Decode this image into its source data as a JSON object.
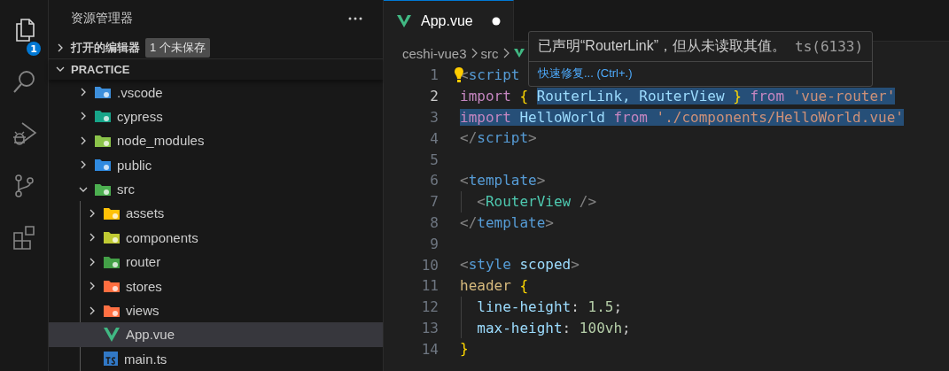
{
  "activity_bar": {
    "items": [
      {
        "kind": "explorer",
        "selected": true,
        "badge": "1"
      },
      {
        "kind": "search",
        "selected": false
      },
      {
        "kind": "debug",
        "selected": false
      },
      {
        "kind": "source-control",
        "selected": false
      },
      {
        "kind": "extensions",
        "selected": false
      }
    ]
  },
  "sidebar": {
    "title": "资源管理器",
    "sections": [
      {
        "title": "打开的编辑器",
        "expanded": false,
        "badge": "1 个未保存"
      },
      {
        "title": "PRACTICE",
        "expanded": true
      }
    ],
    "tree": [
      {
        "label": ".vscode",
        "kind": "folder",
        "color": "#3d8fdc",
        "expanded": false,
        "selected": false
      },
      {
        "label": "cypress",
        "kind": "folder",
        "color": "#17a589",
        "expanded": false,
        "selected": false
      },
      {
        "label": "node_modules",
        "kind": "folder",
        "color": "#8bc34a",
        "expanded": false,
        "selected": false
      },
      {
        "label": "public",
        "kind": "folder",
        "color": "#2f8ae0",
        "expanded": false,
        "selected": false
      },
      {
        "label": "src",
        "kind": "folder",
        "color": "#4caf50",
        "expanded": true,
        "selected": false,
        "children": [
          {
            "label": "assets",
            "kind": "folder",
            "color": "#ffc107",
            "expanded": false,
            "selected": false
          },
          {
            "label": "components",
            "kind": "folder",
            "color": "#c0ca33",
            "expanded": false,
            "selected": false
          },
          {
            "label": "router",
            "kind": "folder",
            "color": "#43a047",
            "expanded": false,
            "selected": false
          },
          {
            "label": "stores",
            "kind": "folder",
            "color": "#ff6e40",
            "expanded": false,
            "selected": false
          },
          {
            "label": "views",
            "kind": "folder",
            "color": "#ff7043",
            "expanded": false,
            "selected": false
          },
          {
            "label": "App.vue",
            "kind": "vue",
            "selected": true
          },
          {
            "label": "main.ts",
            "kind": "ts",
            "selected": false
          }
        ]
      }
    ]
  },
  "editor": {
    "tabs": [
      {
        "label": "App.vue",
        "selected": true,
        "modified": true
      }
    ],
    "breadcrumbs": [
      "ceshi-vue3",
      "src"
    ],
    "lines": [
      {
        "number": "1",
        "current": false,
        "guide": false,
        "tokens": [
          {
            "text": "<",
            "kind": "punct",
            "selected": false
          },
          {
            "text": "script",
            "kind": "tag",
            "selected": false
          }
        ]
      },
      {
        "number": "2",
        "current": true,
        "guide": false,
        "tokens": [
          {
            "text": "import",
            "kind": "keyword",
            "selected": false
          },
          {
            "text": " { ",
            "kind": "brace",
            "selected": false
          },
          {
            "text": "RouterLink",
            "kind": "variable",
            "selected": true
          },
          {
            "text": ", RouterView ",
            "kind": "variable",
            "selected": true
          },
          {
            "text": "}",
            "kind": "brace",
            "selected": true
          },
          {
            "text": " from ",
            "kind": "keyword",
            "selected": true
          },
          {
            "text": "'vue-router'",
            "kind": "string",
            "selected": true
          }
        ]
      },
      {
        "number": "3",
        "current": false,
        "guide": false,
        "tokens": [
          {
            "text": "import",
            "kind": "keyword",
            "selected": true
          },
          {
            "text": " HelloWorld ",
            "kind": "variable",
            "selected": true
          },
          {
            "text": "from ",
            "kind": "keyword",
            "selected": true
          },
          {
            "text": "'./components/HelloWorld.vue'",
            "kind": "string",
            "selected": true
          }
        ]
      },
      {
        "number": "4",
        "current": false,
        "guide": false,
        "tokens": [
          {
            "text": "</",
            "kind": "punct",
            "selected": false
          },
          {
            "text": "script",
            "kind": "tag",
            "selected": false
          },
          {
            "text": ">",
            "kind": "punct",
            "selected": false
          }
        ]
      },
      {
        "number": "5",
        "current": false
      },
      {
        "number": "6",
        "current": false,
        "guide": false,
        "tokens": [
          {
            "text": "<",
            "kind": "punct",
            "selected": false
          },
          {
            "text": "template",
            "kind": "tag",
            "selected": false
          },
          {
            "text": ">",
            "kind": "punct",
            "selected": false
          }
        ]
      },
      {
        "number": "7",
        "current": false,
        "guide": true,
        "tokens": [
          {
            "text": "  <",
            "kind": "punct",
            "selected": false
          },
          {
            "text": "RouterView",
            "kind": "component",
            "selected": false
          },
          {
            "text": " />",
            "kind": "punct",
            "selected": false
          }
        ]
      },
      {
        "number": "8",
        "current": false,
        "guide": false,
        "tokens": [
          {
            "text": "</",
            "kind": "punct",
            "selected": false
          },
          {
            "text": "template",
            "kind": "tag",
            "selected": false
          },
          {
            "text": ">",
            "kind": "punct",
            "selected": false
          }
        ]
      },
      {
        "number": "9",
        "current": false
      },
      {
        "number": "10",
        "current": false,
        "guide": false,
        "tokens": [
          {
            "text": "<",
            "kind": "punct",
            "selected": false
          },
          {
            "text": "style",
            "kind": "tag",
            "selected": false
          },
          {
            "text": " scoped",
            "kind": "attribute",
            "selected": false
          },
          {
            "text": ">",
            "kind": "punct",
            "selected": false
          }
        ]
      },
      {
        "number": "11",
        "current": false,
        "guide": false,
        "tokens": [
          {
            "text": "header ",
            "kind": "selector",
            "selected": false
          },
          {
            "text": "{",
            "kind": "brace",
            "selected": false
          }
        ]
      },
      {
        "number": "12",
        "current": false,
        "guide": true,
        "tokens": [
          {
            "text": "  line-height",
            "kind": "property",
            "selected": false
          },
          {
            "text": ": ",
            "kind": "plain",
            "selected": false
          },
          {
            "text": "1.5",
            "kind": "number",
            "selected": false
          },
          {
            "text": ";",
            "kind": "plain",
            "selected": false
          }
        ]
      },
      {
        "number": "13",
        "current": false,
        "guide": true,
        "tokens": [
          {
            "text": "  max-height",
            "kind": "property",
            "selected": false
          },
          {
            "text": ": ",
            "kind": "plain",
            "selected": false
          },
          {
            "text": "100vh",
            "kind": "number",
            "selected": false
          },
          {
            "text": ";",
            "kind": "plain",
            "selected": false
          }
        ]
      },
      {
        "number": "14",
        "current": false,
        "guide": false,
        "tokens": [
          {
            "text": "}",
            "kind": "brace",
            "selected": false
          }
        ]
      }
    ],
    "hover": {
      "message": "已声明“RouterLink”，但从未读取其值。",
      "code": "ts(6133)",
      "action": "快速修复... (Ctrl+.)"
    }
  }
}
